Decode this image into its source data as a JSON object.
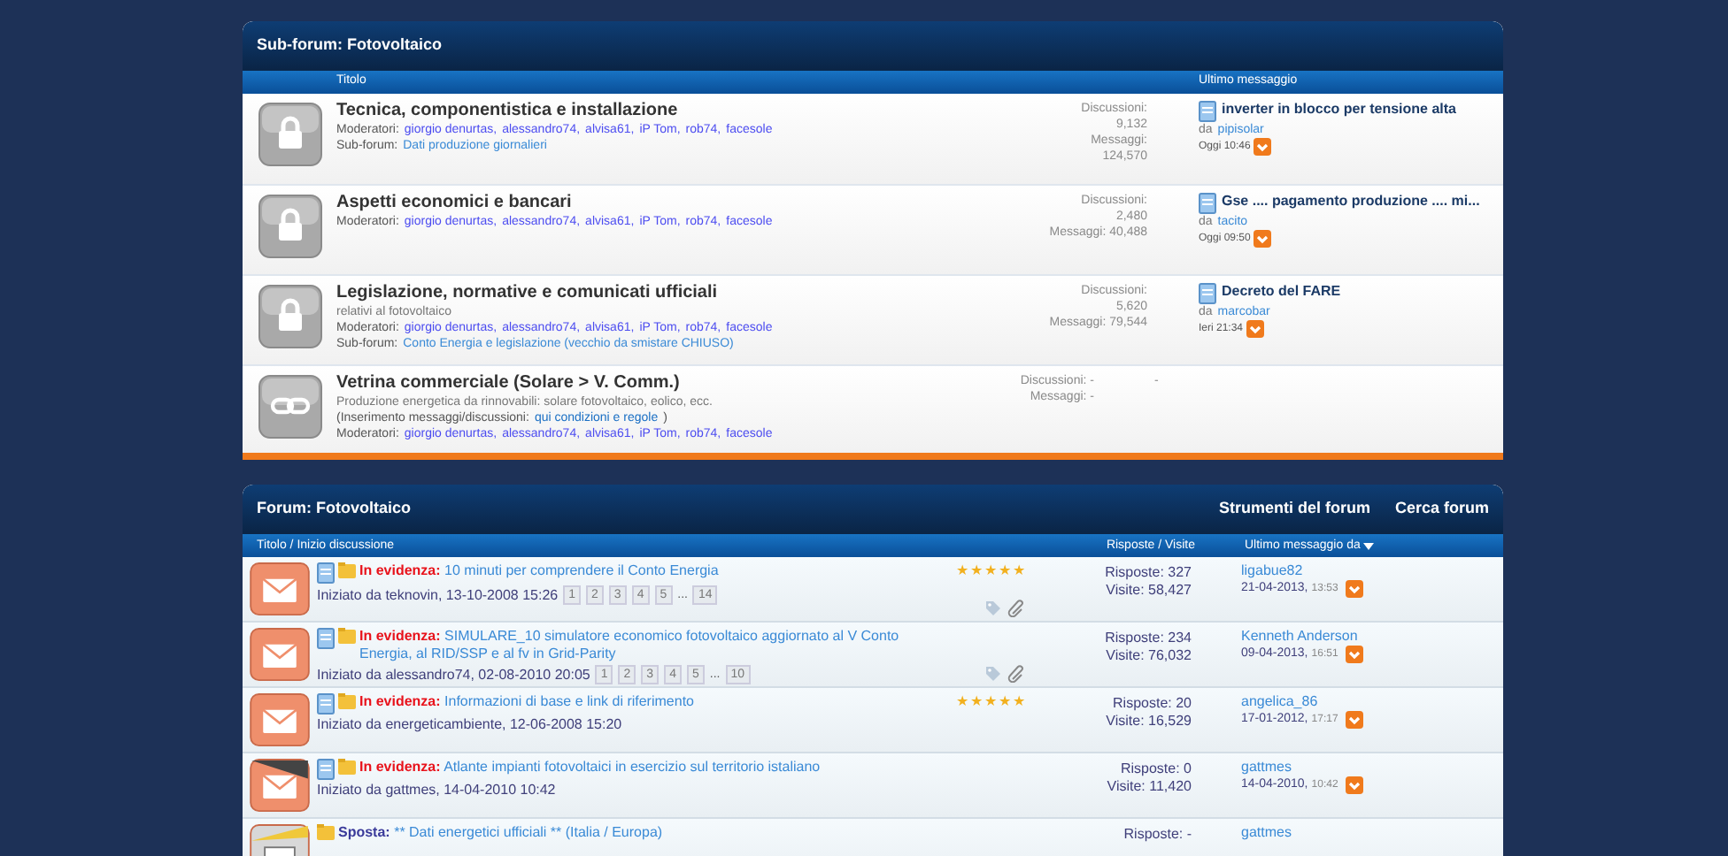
{
  "subforum_panel": {
    "title": "Sub-forum: Fotovoltaico",
    "columns": [
      "Titolo",
      "Ultimo messaggio"
    ],
    "forums": [
      {
        "kind": "lock",
        "title": "Tecnica, componentistica e installazione",
        "moderators_label": "Moderatori:",
        "moderators": [
          "giorgio denurtas,",
          "alessandro74,",
          "alvisa61,",
          "iP Tom,",
          "rob74,",
          "facesole"
        ],
        "subforums_label": "Sub-forum:",
        "subforums": [
          "Dati produzione giornalieri"
        ],
        "stats": [
          "Discussioni:",
          "9,132",
          "Messaggi:",
          "124,570"
        ],
        "last_post": {
          "title": "inverter in blocco per tensione alta",
          "by": "da",
          "user": "pipisolar",
          "time": "Oggi 10:46"
        }
      },
      {
        "kind": "lock",
        "title": "Aspetti economici e bancari",
        "moderators_label": "Moderatori:",
        "moderators": [
          "giorgio denurtas,",
          "alessandro74,",
          "alvisa61,",
          "iP Tom,",
          "rob74,",
          "facesole"
        ],
        "stats": [
          "Discussioni:",
          "2,480",
          "Messaggi: 40,488"
        ],
        "last_post": {
          "title": "Gse .... pagamento produzione .... mi...",
          "by": "da",
          "user": "tacito",
          "time": "Oggi 09:50"
        }
      },
      {
        "kind": "lock",
        "title": "Legislazione, normative e comunicati ufficiali",
        "description": "relativi al fotovoltaico",
        "moderators_label": "Moderatori:",
        "moderators": [
          "giorgio denurtas,",
          "alessandro74,",
          "alvisa61,",
          "iP Tom,",
          "rob74,",
          "facesole"
        ],
        "subforums_label": "Sub-forum:",
        "subforums": [
          "Conto Energia e legislazione (vecchio da smistare CHIUSO)"
        ],
        "stats": [
          "Discussioni:",
          "5,620",
          "Messaggi: 79,544"
        ],
        "last_post": {
          "title": "Decreto del FARE",
          "by": "da",
          "user": "marcobar",
          "time": "Ieri 21:34"
        }
      },
      {
        "kind": "link",
        "title": "Vetrina commerciale (Solare > V. Comm.)",
        "description": "Produzione energetica da rinnovabili: solare fotovoltaico, eolico, ecc.",
        "note_before": "(Inserimento messaggi/discussioni:",
        "note_link": "qui condizioni e regole",
        "note_after": ")",
        "moderators_label": "Moderatori:",
        "moderators": [
          "giorgio denurtas,",
          "alessandro74,",
          "alvisa61,",
          "iP Tom,",
          "rob74,",
          "facesole"
        ],
        "stats": [
          "Discussioni: -",
          "Messaggi: -"
        ],
        "stats_aside": "-"
      }
    ]
  },
  "forum_panel": {
    "title": "Forum: Fotovoltaico",
    "tools": [
      "Strumenti del forum",
      "Cerca forum"
    ],
    "columns": [
      "Titolo / Inizio discussione",
      "Risposte / Visite",
      "Ultimo messaggio da"
    ],
    "threads": [
      {
        "kind": "mail",
        "prefix": "In evidenza:",
        "title": "10 minuti per comprendere il Conto Energia",
        "started": "Iniziato da teknovin, 13-10-2008 15:26",
        "pages": [
          "1",
          "2",
          "3",
          "4",
          "5",
          "...",
          "14"
        ],
        "stars": 5,
        "attachments": true,
        "replies": "Risposte: 327",
        "views": "Visite: 58,427",
        "last_user": "ligabue82",
        "last_date": "21-04-2013,",
        "last_time": "13:53"
      },
      {
        "kind": "mail",
        "prefix": "In evidenza:",
        "title": "SIMULARE_10 simulatore economico fotovoltaico aggiornato al V Conto Energia, al RID/SSP e al fv in Grid-Parity",
        "started": "Iniziato da alessandro74, 02-08-2010 20:05",
        "pages": [
          "1",
          "2",
          "3",
          "4",
          "5",
          "...",
          "10"
        ],
        "attachments": true,
        "replies": "Risposte: 234",
        "views": "Visite: 76,032",
        "last_user": "Kenneth Anderson",
        "last_date": "09-04-2013,",
        "last_time": "16:51"
      },
      {
        "kind": "mail",
        "prefix": "In evidenza:",
        "title": "Informazioni di base e link di riferimento",
        "started": "Iniziato da energeticambiente, 12-06-2008 15:20",
        "stars": 5,
        "attachments": false,
        "replies": "Risposte: 20",
        "views": "Visite: 16,529",
        "last_user": "angelica_86",
        "last_date": "17-01-2012,",
        "last_time": "17:17"
      },
      {
        "kind": "mail-dark",
        "prefix": "In evidenza:",
        "title": "Atlante impianti fotovoltaici in esercizio sul territorio istaliano",
        "started": "Iniziato da gattmes, 14-04-2010 10:42",
        "attachments": false,
        "replies": "Risposte: 0",
        "views": "Visite: 11,420",
        "last_user": "gattmes",
        "last_date": "14-04-2010,",
        "last_time": "10:42"
      },
      {
        "kind": "moved",
        "prefix": "Sposta:",
        "title": "** Dati energetici ufficiali ** (Italia / Europa)",
        "attachments": false,
        "replies": "Risposte: -",
        "last_user": "gattmes"
      }
    ]
  }
}
